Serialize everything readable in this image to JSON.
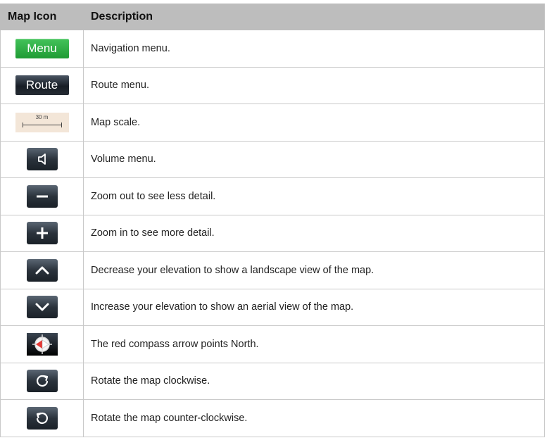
{
  "headers": {
    "icon": "Map Icon",
    "description": "Description"
  },
  "rows": [
    {
      "icon": "menu-button",
      "label": "Menu",
      "description": "Navigation menu."
    },
    {
      "icon": "route-button",
      "label": "Route",
      "description": "Route menu."
    },
    {
      "icon": "map-scale",
      "label": "30 m",
      "description": "Map scale."
    },
    {
      "icon": "speaker-icon",
      "description": "Volume menu."
    },
    {
      "icon": "minus-icon",
      "description": "Zoom out to see less detail."
    },
    {
      "icon": "plus-icon",
      "description": "Zoom in to see more detail."
    },
    {
      "icon": "chevron-up-icon",
      "description": "Decrease your elevation to show a landscape view of the map."
    },
    {
      "icon": "chevron-down-icon",
      "description": "Increase your elevation to show an aerial view of the map."
    },
    {
      "icon": "compass-icon",
      "description": "The red compass arrow points North."
    },
    {
      "icon": "rotate-clockwise-icon",
      "description": "Rotate the map clockwise."
    },
    {
      "icon": "rotate-counterclockwise-icon",
      "description": "Rotate the map counter-clockwise."
    }
  ],
  "colors": {
    "header_bg": "#bdbdbd",
    "menu_green": "#2fb046",
    "button_dark": "#2b333c",
    "compass_red": "#e53935"
  }
}
